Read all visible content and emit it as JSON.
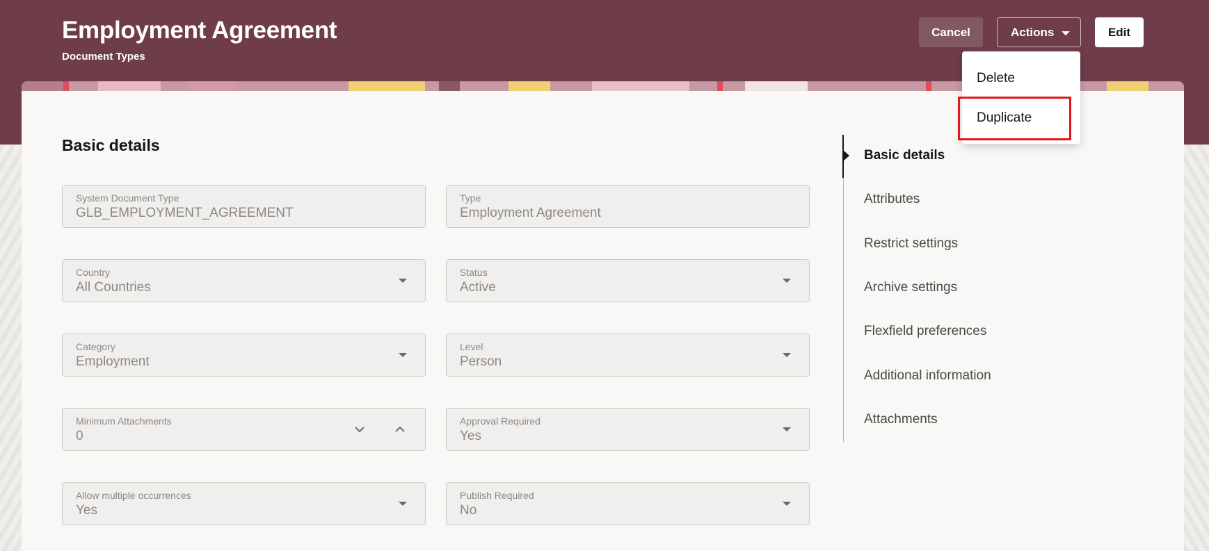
{
  "header": {
    "title": "Employment Agreement",
    "subtitle": "Document Types",
    "cancel_label": "Cancel",
    "actions_label": "Actions",
    "edit_label": "Edit"
  },
  "actions_menu": {
    "items": [
      {
        "label": "Delete"
      },
      {
        "label": "Duplicate",
        "highlighted": true
      }
    ]
  },
  "section": {
    "title": "Basic details"
  },
  "fields": [
    {
      "label": "System Document Type",
      "value": "GLB_EMPLOYMENT_AGREEMENT",
      "control": "text"
    },
    {
      "label": "Type",
      "value": "Employment Agreement",
      "control": "text"
    },
    {
      "label": "Country",
      "value": "All Countries",
      "control": "dropdown"
    },
    {
      "label": "Status",
      "value": "Active",
      "control": "dropdown"
    },
    {
      "label": "Category",
      "value": "Employment",
      "control": "dropdown"
    },
    {
      "label": "Level",
      "value": "Person",
      "control": "dropdown"
    },
    {
      "label": "Minimum Attachments",
      "value": "0",
      "control": "stepper"
    },
    {
      "label": "Approval Required",
      "value": "Yes",
      "control": "dropdown"
    },
    {
      "label": "Allow multiple occurrences",
      "value": "Yes",
      "control": "dropdown"
    },
    {
      "label": "Publish Required",
      "value": "No",
      "control": "dropdown"
    }
  ],
  "side_nav": {
    "items": [
      {
        "label": "Basic details",
        "active": true
      },
      {
        "label": "Attributes"
      },
      {
        "label": "Restrict settings"
      },
      {
        "label": "Archive settings"
      },
      {
        "label": "Flexfield preferences"
      },
      {
        "label": "Additional information"
      },
      {
        "label": "Attachments"
      }
    ]
  },
  "icons": {
    "dropdown": "caret-down-icon",
    "stepper_down": "chevron-down-icon",
    "stepper_up": "chevron-up-icon",
    "nav_marker": "triangle-right-icon"
  },
  "colors": {
    "header_bg": "#6f3d49",
    "highlight_box": "#e0181e",
    "card_bg": "#f9f8f6"
  }
}
